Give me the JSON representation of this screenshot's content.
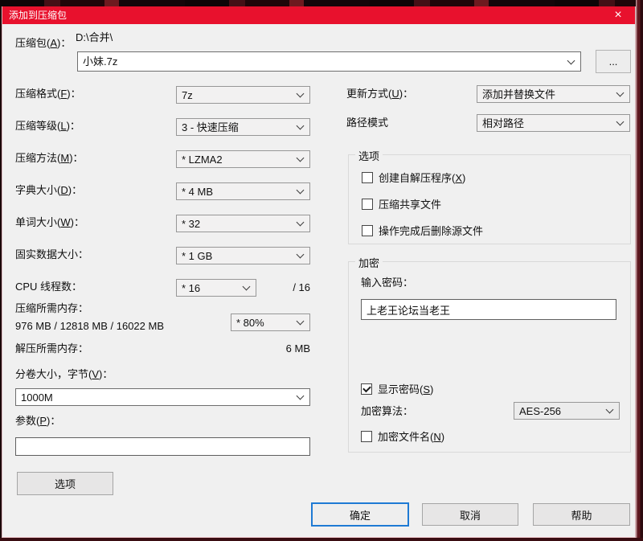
{
  "window": {
    "title": "添加到压缩包",
    "close_icon": "×"
  },
  "archive": {
    "label": "压缩包(A)：",
    "path": "D:\\合并\\",
    "name": "小妹.7z",
    "browse": "..."
  },
  "left": {
    "rows": [
      {
        "label": "压缩格式(F)：",
        "value": "7z"
      },
      {
        "label": "压缩等级(L)：",
        "value": "3 - 快速压缩"
      },
      {
        "label": "压缩方法(M)：",
        "value": "* LZMA2"
      },
      {
        "label": "字典大小(D)：",
        "value": "* 4 MB"
      },
      {
        "label": "单词大小(W)：",
        "value": "* 32"
      },
      {
        "label": "固实数据大小：",
        "value": "* 1 GB"
      }
    ],
    "cpu": {
      "label": "CPU 线程数：",
      "value": "* 16",
      "suffix": "/ 16"
    },
    "mem_compress": {
      "label": "压缩所需内存：",
      "detail": "976 MB / 12818 MB / 16022 MB",
      "percent": "* 80%"
    },
    "mem_decompress": {
      "label": "解压所需内存：",
      "value": "6 MB"
    },
    "volume": {
      "label": "分卷大小，字节(V)：",
      "value": "1000M"
    },
    "params": {
      "label": "参数(P)：",
      "value": ""
    },
    "options_button": "选项"
  },
  "right": {
    "update_mode": {
      "label": "更新方式(U)：",
      "value": "添加并替换文件"
    },
    "path_mode": {
      "label": "路径模式",
      "value": "相对路径"
    }
  },
  "options_group": {
    "title": "选项",
    "items": [
      {
        "label": "创建自解压程序(X)",
        "checked": false
      },
      {
        "label": "压缩共享文件",
        "checked": false
      },
      {
        "label": "操作完成后删除源文件",
        "checked": false
      }
    ]
  },
  "encryption": {
    "title": "加密",
    "password_label": "输入密码：",
    "password": "上老王论坛当老王",
    "show_password": {
      "label": "显示密码(S)",
      "checked": true
    },
    "method": {
      "label": "加密算法：",
      "value": "AES-256"
    },
    "encrypt_names": {
      "label": "加密文件名(N)",
      "checked": false
    }
  },
  "footer": {
    "ok": "确定",
    "cancel": "取消",
    "help": "帮助"
  },
  "colors": {
    "titlebar": "#e8112d",
    "dialog_bg": "#f0f0f0",
    "focus_accent": "#1e7ad4"
  }
}
